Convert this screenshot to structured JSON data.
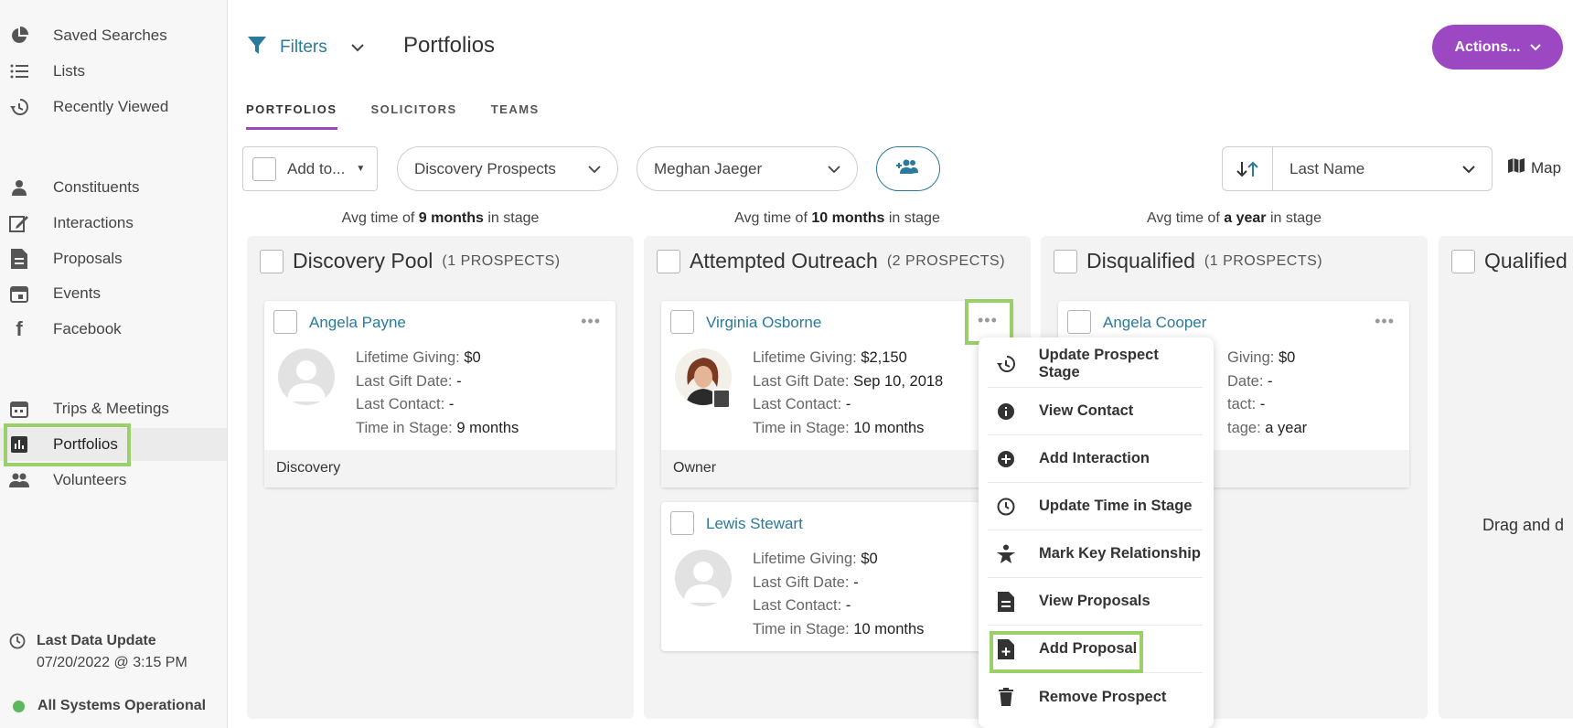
{
  "sidebar": {
    "items": [
      {
        "label": "Saved Searches",
        "icon": "pie-chart-icon"
      },
      {
        "label": "Lists",
        "icon": "list-icon"
      },
      {
        "label": "Recently Viewed",
        "icon": "history-icon"
      },
      {
        "label": "Constituents",
        "icon": "person-icon"
      },
      {
        "label": "Interactions",
        "icon": "edit-icon"
      },
      {
        "label": "Proposals",
        "icon": "document-icon"
      },
      {
        "label": "Events",
        "icon": "calendar-icon"
      },
      {
        "label": "Facebook",
        "icon": "facebook-icon"
      },
      {
        "label": "Trips & Meetings",
        "icon": "calendar-grid-icon"
      },
      {
        "label": "Portfolios",
        "icon": "bar-chart-icon",
        "active": true
      },
      {
        "label": "Volunteers",
        "icon": "people-icon"
      }
    ],
    "last_update_label": "Last Data Update",
    "last_update_value": "07/20/2022 @ 3:15 PM",
    "system_status": "All Systems Operational",
    "status_color": "#5cb85c"
  },
  "header": {
    "filters_label": "Filters",
    "title": "Portfolios",
    "actions_label": "Actions...",
    "accent": "#9b48c2",
    "link_color": "#2a7a9b"
  },
  "tabs": [
    {
      "label": "PORTFOLIOS",
      "active": true
    },
    {
      "label": "SOLICITORS"
    },
    {
      "label": "TEAMS"
    }
  ],
  "toolbar": {
    "add_to_label": "Add to...",
    "stage_select": "Discovery Prospects",
    "solicitor_select": "Meghan Jaeger",
    "sort_select": "Last Name",
    "map_label": "Map"
  },
  "columns": [
    {
      "avg_prefix": "Avg time of",
      "avg_value": "9 months",
      "avg_suffix": "in stage",
      "title": "Discovery Pool",
      "count": "(1 PROSPECTS)"
    },
    {
      "avg_prefix": "Avg time of",
      "avg_value": "10 months",
      "avg_suffix": "in stage",
      "title": "Attempted Outreach",
      "count": "(2 PROSPECTS)"
    },
    {
      "avg_prefix": "Avg time of",
      "avg_value": "a year",
      "avg_suffix": "in stage",
      "title": "Disqualified",
      "count": "(1 PROSPECTS)"
    },
    {
      "title": "Qualified"
    }
  ],
  "field_labels": {
    "lifetime": "Lifetime Giving:",
    "last_gift": "Last Gift Date:",
    "last_contact": "Last Contact:",
    "time_in_stage": "Time in Stage:"
  },
  "cards": {
    "angela_payne": {
      "name": "Angela Payne",
      "lifetime": "$0",
      "last_gift": "-",
      "last_contact": "-",
      "time_in_stage": "9 months",
      "footer": "Discovery"
    },
    "virginia_osborne": {
      "name": "Virginia Osborne",
      "lifetime": "$2,150",
      "last_gift": "Sep 10, 2018",
      "last_contact": "-",
      "time_in_stage": "10 months",
      "footer": "Owner"
    },
    "lewis_stewart": {
      "name": "Lewis Stewart",
      "lifetime": "$0",
      "last_gift": "-",
      "last_contact": "-",
      "time_in_stage": "10 months"
    },
    "angela_cooper": {
      "name": "Angela Cooper",
      "lifetime_frag": "Giving:",
      "lifetime": "$0",
      "last_gift_frag": "Date:",
      "last_gift": "-",
      "last_contact_frag": "tact:",
      "last_contact": "-",
      "time_frag": "tage:",
      "time_in_stage": "a year"
    }
  },
  "card_menu": {
    "items": [
      {
        "label": "Update Prospect Stage",
        "icon": "history-icon"
      },
      {
        "label": "View Contact",
        "icon": "info-icon"
      },
      {
        "label": "Add Interaction",
        "icon": "plus-circle-icon"
      },
      {
        "label": "Update Time in Stage",
        "icon": "clock-icon"
      },
      {
        "label": "Mark Key Relationship",
        "icon": "person-star-icon"
      },
      {
        "label": "View Proposals",
        "icon": "document-icon"
      },
      {
        "label": "Add Proposal",
        "icon": "document-add-icon"
      },
      {
        "label": "Remove Prospect",
        "icon": "trash-icon"
      }
    ]
  },
  "drag_hint": "Drag and d",
  "highlight_color": "#9ad069"
}
